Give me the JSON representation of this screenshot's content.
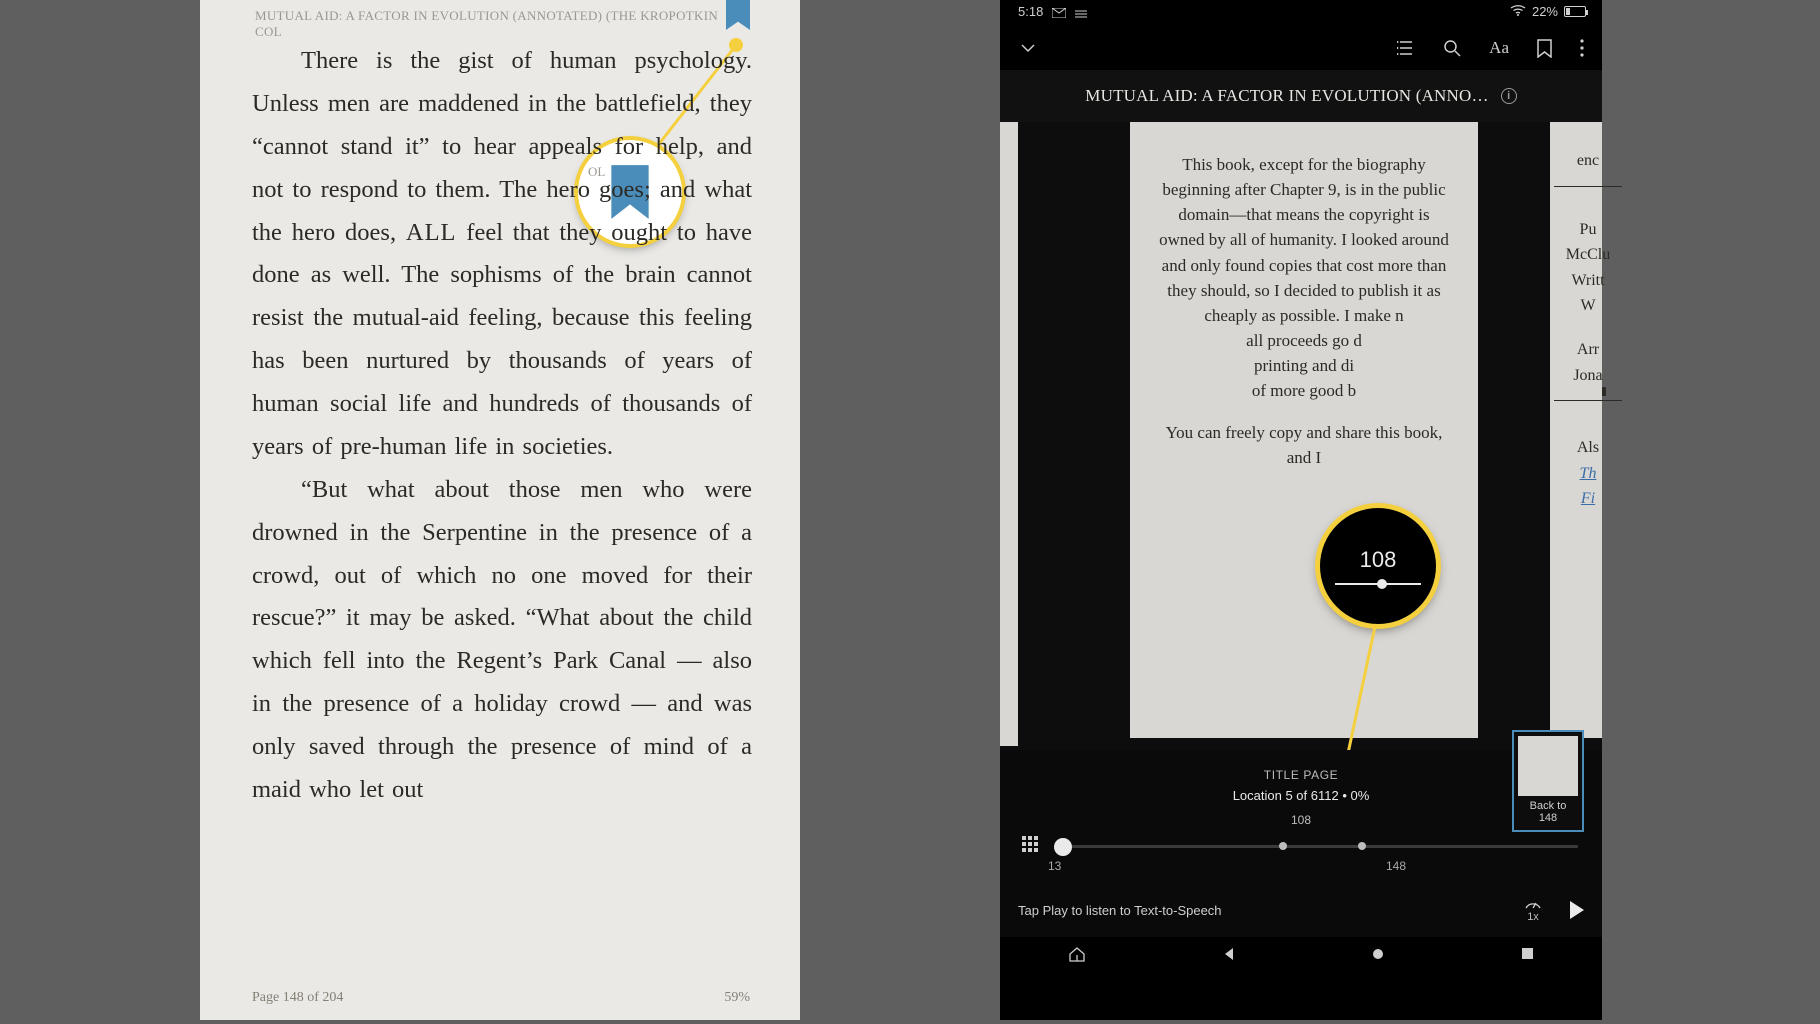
{
  "left": {
    "header": "MUTUAL AID: A FACTOR IN EVOLUTION (ANNOTATED) (THE KROPOTKIN COL",
    "header_overflow": "OL",
    "para1_a": "There is the gist of human psy­chology. Unless men are maddened in the battlefield, they “cannot stand it” to hear appeals for help, and not to respond to them. The hero goes; and what the hero does, ",
    "para1_all": "ALL",
    "para1_b": " feel that they ought to have done as well. The sophisms of the brain cannot resist the mutual-aid feeling, because this feeling has been nurtured by thou­sands of years of human social life and hundreds of thousands of years of pre-human life in societies.",
    "para2": "“But what about those men who were drowned in the Serpentine in the presence of a crowd, out of which no one moved for their rescue?” it may be asked. “What about the child which fell into the Regent’s Park Canal — also in the presence of a holiday crowd — and was only saved through the pres­ence of mind of a maid who let out",
    "page": "Page 148 of 204",
    "percent": "59%"
  },
  "right": {
    "status": {
      "time": "5:18",
      "battery_pct": "22%"
    },
    "title": "MUTUAL AID: A FACTOR IN EVOLUTION (ANNO…",
    "preview_main_a": "This book, except for the biography beginning after Chapter 9, is in the public domain—that means the copyright is owned by all of humanity. I looked around and only found copies that cost more than they should, so I decided to publish it as cheaply as possible. I make n",
    "preview_main_b": "all proceeds go d",
    "preview_main_c": "printing and di",
    "preview_main_d": "of more good b",
    "preview_main_e": "You can freely copy and share this book, and I",
    "peek": {
      "enc": "enc",
      "pu": "Pu",
      "mcclu": "McClu",
      "writt": "Writt",
      "w": "W",
      "arr": "Arr",
      "jon": "Jona",
      "als": "Als",
      "th": "Th",
      "fi": "Fi"
    },
    "scrub": {
      "caption": "TITLE PAGE",
      "location": "Location 5 of 6112  •  0%",
      "mid": "108",
      "label_left": "13",
      "label_right": "148"
    },
    "backto": {
      "line1": "Back to",
      "line2": "148"
    },
    "tts": {
      "text": "Tap Play to listen to Text-to-Speech",
      "speed": "1x"
    },
    "magnifier": {
      "value": "108"
    }
  }
}
